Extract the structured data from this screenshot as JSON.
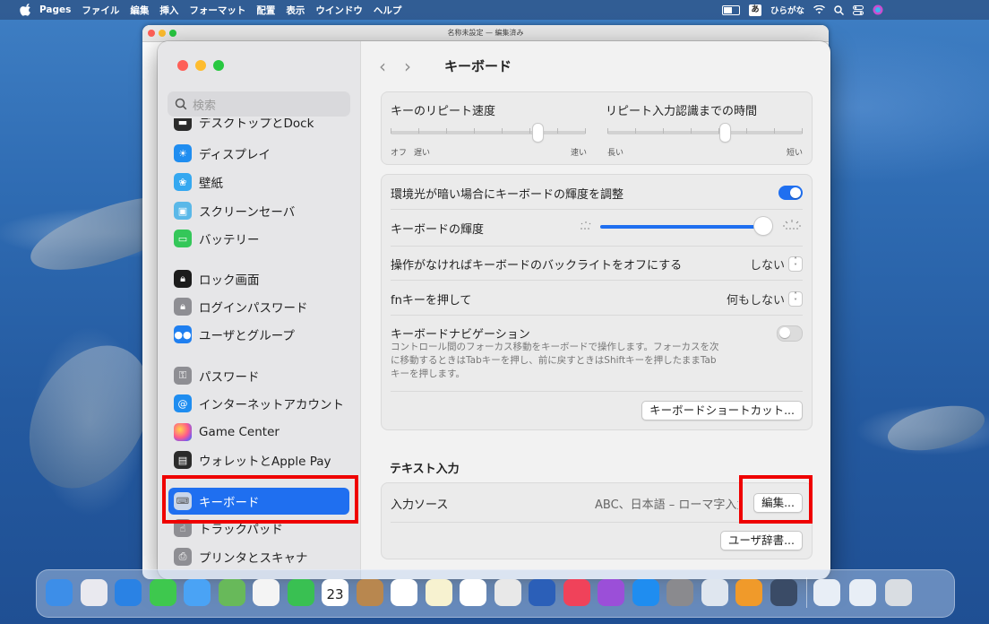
{
  "menubar": {
    "app": "Pages",
    "items": [
      "ファイル",
      "編集",
      "挿入",
      "フォーマット",
      "配置",
      "表示",
      "ウインドウ",
      "ヘルプ"
    ],
    "ime_glyph": "あ",
    "ime_label": "ひらがな"
  },
  "pages_window": {
    "title": "名称未設定 — 編集済み"
  },
  "sidebar": {
    "search_placeholder": "検索",
    "items": [
      {
        "label": "デスクトップとDock",
        "icon": "dock-icon",
        "color": "#2b2b2b"
      },
      {
        "label": "ディスプレイ",
        "icon": "display-icon",
        "color": "#1f8df0"
      },
      {
        "label": "壁紙",
        "icon": "wallpaper-icon",
        "color": "#35a8f0"
      },
      {
        "label": "スクリーンセーバ",
        "icon": "screensaver-icon",
        "color": "#5ab8e8"
      },
      {
        "label": "バッテリー",
        "icon": "battery-icon",
        "color": "#34c759"
      },
      {
        "label": "ロック画面",
        "icon": "lock-icon",
        "color": "#1c1c1c"
      },
      {
        "label": "ログインパスワード",
        "icon": "login-password-icon",
        "color": "#8e8e93"
      },
      {
        "label": "ユーザとグループ",
        "icon": "users-icon",
        "color": "#1f7ff0"
      },
      {
        "label": "パスワード",
        "icon": "key-icon",
        "color": "#8e8e93"
      },
      {
        "label": "インターネットアカウント",
        "icon": "at-icon",
        "color": "#1f8df0"
      },
      {
        "label": "Game Center",
        "icon": "game-center-icon",
        "color": "#e85a8a"
      },
      {
        "label": "ウォレットとApple Pay",
        "icon": "wallet-icon",
        "color": "#2b2b2b"
      },
      {
        "label": "キーボード",
        "icon": "keyboard-icon",
        "color": "#8e8e93",
        "selected": true
      },
      {
        "label": "トラックパッド",
        "icon": "trackpad-icon",
        "color": "#8e8e93"
      },
      {
        "label": "プリンタとスキャナ",
        "icon": "printer-icon",
        "color": "#8e8e93"
      }
    ]
  },
  "main": {
    "title": "キーボード",
    "repeat": {
      "label_speed": "キーのリピート速度",
      "label_delay": "リピート入力認識までの時間",
      "speed_min_off": "オフ",
      "speed_min": "遅い",
      "speed_max": "速い",
      "delay_min": "長い",
      "delay_max": "短い",
      "speed_value": 0.75,
      "delay_value": 0.6
    },
    "settings": {
      "auto_brightness_label": "環境光が暗い場合にキーボードの輝度を調整",
      "auto_brightness_on": true,
      "brightness_label": "キーボードの輝度",
      "brightness_value": 0.95,
      "backlight_label": "操作がなければキーボードのバックライトをオフにする",
      "backlight_value": "しない",
      "fn_label": "fnキーを押して",
      "fn_value": "何もしない",
      "nav_label": "キーボードナビゲーション",
      "nav_on": false,
      "nav_caption_1": "コントロール間のフォーカス移動をキーボードで操作します。フォーカスを次",
      "nav_caption_2": "に移動するときはTabキーを押し、前に戻すときはShiftキーを押したままTab",
      "nav_caption_3": "キーを押します。",
      "shortcuts_button": "キーボードショートカット..."
    },
    "text_input": {
      "section_title": "テキスト入力",
      "input_sources_label": "入力ソース",
      "input_sources_value": "ABC、日本語 – ローマ字入力",
      "edit_button": "編集...",
      "dictionary_button": "ユーザ辞書..."
    }
  },
  "dock": {
    "calendar_day": "23",
    "apps": [
      {
        "name": "finder",
        "color": "#3d8ee8"
      },
      {
        "name": "launchpad",
        "color": "#e9e9ef"
      },
      {
        "name": "safari",
        "color": "#2a82e4"
      },
      {
        "name": "messages",
        "color": "#3ec84e"
      },
      {
        "name": "mail",
        "color": "#4aa3f5"
      },
      {
        "name": "maps",
        "color": "#68b95a"
      },
      {
        "name": "photos",
        "color": "#f4f4f4"
      },
      {
        "name": "facetime",
        "color": "#39c052"
      },
      {
        "name": "calendar",
        "color": "#ffffff"
      },
      {
        "name": "contacts",
        "color": "#b8874f"
      },
      {
        "name": "reminders",
        "color": "#ffffff"
      },
      {
        "name": "notes",
        "color": "#f7f2d0"
      },
      {
        "name": "freeform",
        "color": "#ffffff"
      },
      {
        "name": "chrome",
        "color": "#e8e8e8"
      },
      {
        "name": "word",
        "color": "#2b5fb8"
      },
      {
        "name": "music",
        "color": "#f0425a"
      },
      {
        "name": "podcasts",
        "color": "#9b4fd8"
      },
      {
        "name": "app-store",
        "color": "#1f8df0"
      },
      {
        "name": "system-settings",
        "color": "#8a8a8e"
      },
      {
        "name": "preview",
        "color": "#dfe6ef"
      },
      {
        "name": "pages",
        "color": "#f09a2a"
      },
      {
        "name": "quicktime",
        "color": "#3a4b66"
      }
    ]
  }
}
